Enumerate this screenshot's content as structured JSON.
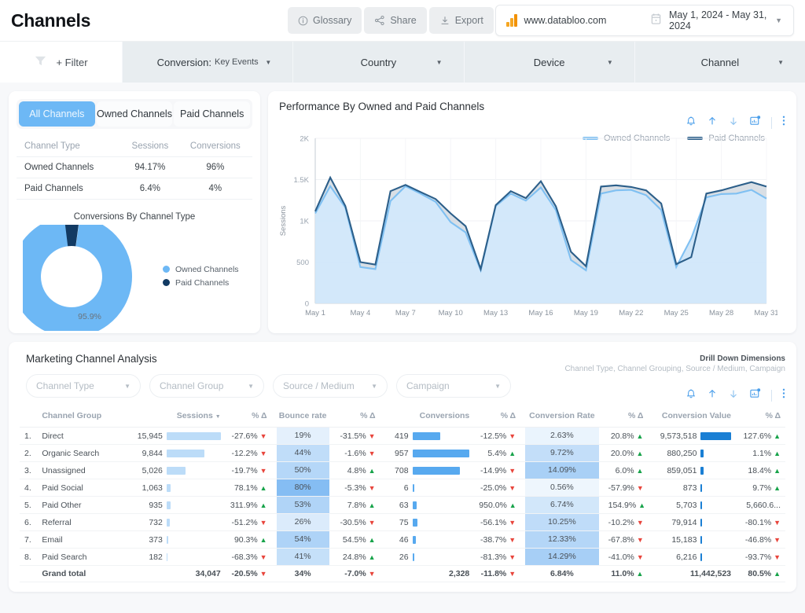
{
  "header": {
    "title": "Channels",
    "actions": [
      {
        "label": "Glossary",
        "icon": "info-icon"
      },
      {
        "label": "Share",
        "icon": "share-icon"
      },
      {
        "label": "Export",
        "icon": "download-icon"
      }
    ],
    "account": "www.databloo.com",
    "date_range": "May 1, 2024 - May 31, 2024"
  },
  "filterbar": {
    "filter_label": "+ Filter",
    "cells": [
      {
        "label": "Conversion:",
        "sub": "Key Events"
      },
      {
        "label": "Country",
        "sub": ""
      },
      {
        "label": "Device",
        "sub": ""
      },
      {
        "label": "Channel",
        "sub": ""
      }
    ]
  },
  "left_card": {
    "tabs": [
      {
        "label": "All Channels",
        "active": true
      },
      {
        "label": "Owned Channels",
        "active": false
      },
      {
        "label": "Paid Channels",
        "active": false
      }
    ],
    "table": {
      "headers": [
        "Channel Type",
        "Sessions",
        "Conversions"
      ],
      "rows": [
        [
          "Owned Channels",
          "94.17%",
          "96%"
        ],
        [
          "Paid Channels",
          "6.4%",
          "4%"
        ]
      ]
    },
    "donut_title": "Conversions By Channel Type",
    "donut_label": "95.9%",
    "legend": [
      {
        "label": "Owned Channels",
        "color": "#6db8f5"
      },
      {
        "label": "Paid Channels",
        "color": "#123a63"
      }
    ]
  },
  "chart_card": {
    "title": "Performance By Owned and Paid Channels",
    "tools": [
      "bell-icon",
      "arrow-up-icon",
      "arrow-down-icon",
      "chart-export-icon",
      "more-vertical-icon"
    ]
  },
  "chart_data": {
    "type": "area",
    "title": "Performance By Owned and Paid Channels",
    "xlabel": "",
    "ylabel": "Sessions",
    "ylim": [
      0,
      2000
    ],
    "yticks": [
      0,
      500,
      1000,
      1500,
      2000
    ],
    "ytick_labels": [
      "0",
      "500",
      "1K",
      "1.5K",
      "2K"
    ],
    "grid": true,
    "legend_position": "top",
    "x": [
      "May 1",
      "May 2",
      "May 3",
      "May 4",
      "May 5",
      "May 6",
      "May 7",
      "May 8",
      "May 9",
      "May 10",
      "May 11",
      "May 12",
      "May 13",
      "May 14",
      "May 15",
      "May 16",
      "May 17",
      "May 18",
      "May 19",
      "May 20",
      "May 21",
      "May 22",
      "May 23",
      "May 24",
      "May 25",
      "May 26",
      "May 27",
      "May 28",
      "May 29",
      "May 30",
      "May 31"
    ],
    "xtick_labels": [
      "May 1",
      "May 4",
      "May 7",
      "May 10",
      "May 13",
      "May 16",
      "May 19",
      "May 22",
      "May 25",
      "May 28",
      "May 31"
    ],
    "series": [
      {
        "name": "Owned Channels",
        "color": "#7fc0f2",
        "values": [
          1090,
          1420,
          1160,
          440,
          415,
          1240,
          1420,
          1330,
          1230,
          985,
          860,
          400,
          1180,
          1330,
          1245,
          1405,
          1130,
          525,
          400,
          1330,
          1370,
          1375,
          1310,
          1130,
          440,
          790,
          1285,
          1325,
          1330,
          1375,
          1270
        ]
      },
      {
        "name": "Paid Channels",
        "color": "#2c5f8a",
        "values": [
          1115,
          1525,
          1180,
          500,
          470,
          1360,
          1435,
          1350,
          1265,
          1090,
          935,
          415,
          1190,
          1360,
          1275,
          1480,
          1175,
          625,
          450,
          1415,
          1430,
          1410,
          1370,
          1210,
          475,
          560,
          1330,
          1370,
          1420,
          1470,
          1415
        ]
      }
    ]
  },
  "bottom_card": {
    "title": "Marketing Channel Analysis",
    "selects": [
      {
        "placeholder": "Channel Type"
      },
      {
        "placeholder": "Channel Group"
      },
      {
        "placeholder": "Source / Medium"
      },
      {
        "placeholder": "Campaign"
      }
    ],
    "drill_title": "Drill Down Dimensions",
    "drill_subtitle": "Channel Type, Channel Grouping, Source / Medium, Campaign",
    "tools": [
      "bell-icon",
      "arrow-up-icon",
      "arrow-down-icon",
      "chart-export-icon",
      "more-vertical-icon"
    ],
    "table": {
      "headers": [
        "",
        "Channel Group",
        "Sessions",
        "% Δ",
        "Bounce rate",
        "% Δ",
        "Conversions",
        "% Δ",
        "Conversion Rate",
        "% Δ",
        "Conversion Value",
        "% Δ"
      ],
      "sorted_column": "Sessions",
      "rows": [
        {
          "idx": "1.",
          "name": "Direct",
          "sessions": "15,945",
          "sessions_pct": 100,
          "d1": "-27.6%",
          "d1_dir": "down",
          "bounce": "19%",
          "bounce_heat": 0.12,
          "d2": "-31.5%",
          "d2_dir": "down",
          "conversions": "419",
          "conv_pct": 43,
          "d3": "-12.5%",
          "d3_dir": "down",
          "rate": "2.63%",
          "rate_heat": 0.06,
          "d4": "20.8%",
          "d4_dir": "up",
          "value": "9,573,518",
          "value_pct": 100,
          "d5": "127.6%",
          "d5_dir": "up"
        },
        {
          "idx": "2.",
          "name": "Organic Search",
          "sessions": "9,844",
          "sessions_pct": 62,
          "d1": "-12.2%",
          "d1_dir": "down",
          "bounce": "44%",
          "bounce_heat": 0.45,
          "d2": "-1.6%",
          "d2_dir": "down",
          "conversions": "957",
          "conv_pct": 100,
          "d3": "5.4%",
          "d3_dir": "up",
          "rate": "9.72%",
          "rate_heat": 0.42,
          "d4": "20.0%",
          "d4_dir": "up",
          "value": "880,250",
          "value_pct": 9,
          "d5": "1.1%",
          "d5_dir": "up"
        },
        {
          "idx": "3.",
          "name": "Unassigned",
          "sessions": "5,026",
          "sessions_pct": 31,
          "d1": "-19.7%",
          "d1_dir": "down",
          "bounce": "50%",
          "bounce_heat": 0.55,
          "d2": "4.8%",
          "d2_dir": "up",
          "conversions": "708",
          "conv_pct": 74,
          "d3": "-14.9%",
          "d3_dir": "down",
          "rate": "14.09%",
          "rate_heat": 0.66,
          "d4": "6.0%",
          "d4_dir": "up",
          "value": "859,051",
          "value_pct": 9,
          "d5": "18.4%",
          "d5_dir": "up"
        },
        {
          "idx": "4.",
          "name": "Paid Social",
          "sessions": "1,063",
          "sessions_pct": 7,
          "d1": "78.1%",
          "d1_dir": "up",
          "bounce": "80%",
          "bounce_heat": 1.0,
          "d2": "-5.3%",
          "d2_dir": "down",
          "conversions": "6",
          "conv_pct": 1,
          "d3": "-25.0%",
          "d3_dir": "down",
          "rate": "0.56%",
          "rate_heat": 0.02,
          "d4": "-57.9%",
          "d4_dir": "down",
          "value": "873",
          "value_pct": 1,
          "d5": "9.7%",
          "d5_dir": "up"
        },
        {
          "idx": "5.",
          "name": "Paid Other",
          "sessions": "935",
          "sessions_pct": 6,
          "d1": "311.9%",
          "d1_dir": "up",
          "bounce": "53%",
          "bounce_heat": 0.6,
          "d2": "7.8%",
          "d2_dir": "up",
          "conversions": "63",
          "conv_pct": 7,
          "d3": "950.0%",
          "d3_dir": "up",
          "rate": "6.74%",
          "rate_heat": 0.28,
          "d4": "154.9%",
          "d4_dir": "up",
          "value": "5,703",
          "value_pct": 1,
          "d5": "5,660.6...",
          "d5_dir": "none"
        },
        {
          "idx": "6.",
          "name": "Referral",
          "sessions": "732",
          "sessions_pct": 5,
          "d1": "-51.2%",
          "d1_dir": "down",
          "bounce": "26%",
          "bounce_heat": 0.2,
          "d2": "-30.5%",
          "d2_dir": "down",
          "conversions": "75",
          "conv_pct": 8,
          "d3": "-56.1%",
          "d3_dir": "down",
          "rate": "10.25%",
          "rate_heat": 0.46,
          "d4": "-10.2%",
          "d4_dir": "down",
          "value": "79,914",
          "value_pct": 1,
          "d5": "-80.1%",
          "d5_dir": "down"
        },
        {
          "idx": "7.",
          "name": "Email",
          "sessions": "373",
          "sessions_pct": 3,
          "d1": "90.3%",
          "d1_dir": "up",
          "bounce": "54%",
          "bounce_heat": 0.62,
          "d2": "54.5%",
          "d2_dir": "up",
          "conversions": "46",
          "conv_pct": 5,
          "d3": "-38.7%",
          "d3_dir": "down",
          "rate": "12.33%",
          "rate_heat": 0.56,
          "d4": "-67.8%",
          "d4_dir": "down",
          "value": "15,183",
          "value_pct": 1,
          "d5": "-46.8%",
          "d5_dir": "down"
        },
        {
          "idx": "8.",
          "name": "Paid Search",
          "sessions": "182",
          "sessions_pct": 2,
          "d1": "-68.3%",
          "d1_dir": "down",
          "bounce": "41%",
          "bounce_heat": 0.4,
          "d2": "24.8%",
          "d2_dir": "up",
          "conversions": "26",
          "conv_pct": 3,
          "d3": "-81.3%",
          "d3_dir": "down",
          "rate": "14.29%",
          "rate_heat": 0.68,
          "d4": "-41.0%",
          "d4_dir": "down",
          "value": "6,216",
          "value_pct": 1,
          "d5": "-93.7%",
          "d5_dir": "down"
        }
      ],
      "grand_total": {
        "label": "Grand total",
        "sessions": "34,047",
        "d1": "-20.5%",
        "d1_dir": "down",
        "bounce": "34%",
        "d2": "-7.0%",
        "d2_dir": "down",
        "conversions": "2,328",
        "d3": "-11.8%",
        "d3_dir": "down",
        "rate": "6.84%",
        "d4": "11.0%",
        "d4_dir": "up",
        "value": "11,442,523",
        "d5": "80.5%",
        "d5_dir": "up"
      }
    }
  },
  "colors": {
    "accent_blue": "#4a9eea",
    "owned": "#6db8f5",
    "paid": "#123a63",
    "up": "#17a34a",
    "down": "#e8453c",
    "bar_light": "#bcdcf8",
    "bar_mid": "#57a9ef",
    "bar_dark": "#1a7fd4"
  }
}
